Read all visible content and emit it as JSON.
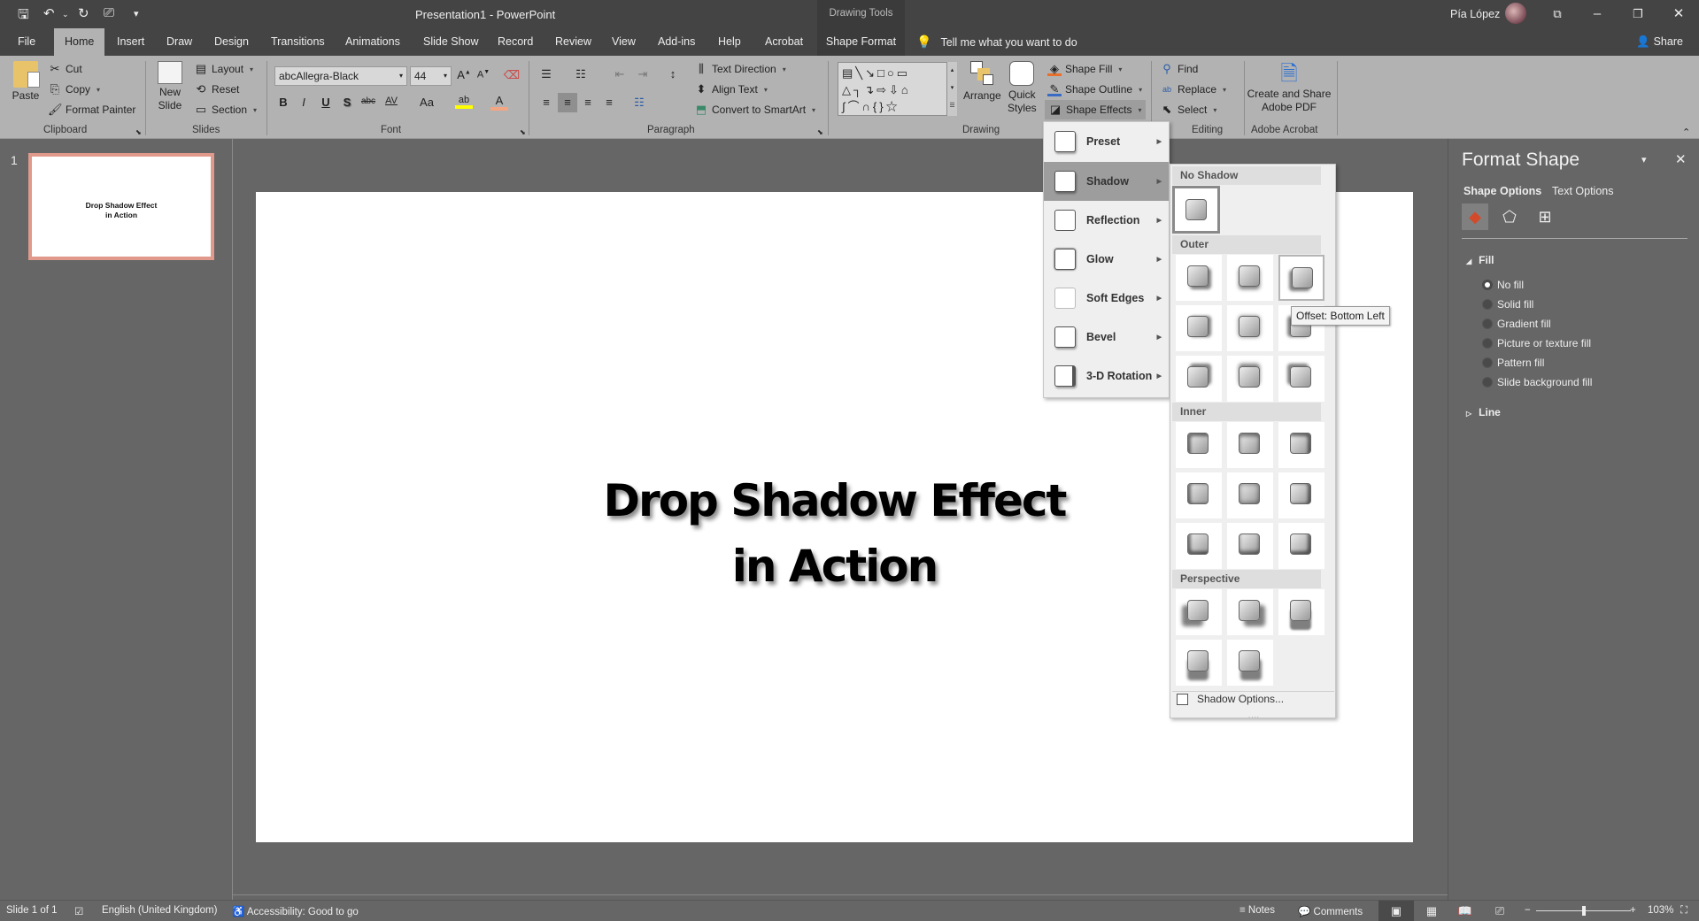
{
  "app": {
    "title": "Presentation1  -  PowerPoint",
    "contextual_group": "Drawing Tools",
    "user_name": "Pía López",
    "qat": {
      "save": "save-icon",
      "undo": "undo-icon",
      "redo": "redo-icon",
      "present": "present-from-start-icon",
      "customize": "customize-qat-icon"
    },
    "window_buttons": [
      "ribbon-display-options",
      "minimize",
      "restore",
      "close"
    ]
  },
  "tabs": [
    "File",
    "Home",
    "Insert",
    "Draw",
    "Design",
    "Transitions",
    "Animations",
    "Slide Show",
    "Record",
    "Review",
    "View",
    "Add-ins",
    "Help",
    "Acrobat",
    "Shape Format"
  ],
  "active_tab": "Home",
  "tell_me": "Tell me what you want to do",
  "share": "Share",
  "ribbon": {
    "clipboard": {
      "label": "Clipboard",
      "paste": "Paste",
      "cut": "Cut",
      "copy": "Copy",
      "format_painter": "Format Painter"
    },
    "slides": {
      "label": "Slides",
      "new_slide_1": "New",
      "new_slide_2": "Slide",
      "layout": "Layout",
      "reset": "Reset",
      "section": "Section"
    },
    "font": {
      "label": "Font",
      "font_name": "abcAllegra-Black",
      "font_size": "44",
      "bold": "B",
      "italic": "I",
      "underline": "U",
      "shadow": "S",
      "strike": "abc",
      "spacing": "AV",
      "case": "Aa",
      "grow": "A",
      "shrink": "A",
      "highlight_color": "#ffff00",
      "font_color": "#f4a582"
    },
    "paragraph": {
      "label": "Paragraph",
      "text_direction": "Text Direction",
      "align_text": "Align Text",
      "convert_smartart": "Convert to SmartArt"
    },
    "drawing": {
      "label": "Drawing",
      "arrange": "Arrange",
      "quick_styles_1": "Quick",
      "quick_styles_2": "Styles",
      "shape_fill": "Shape Fill",
      "shape_outline": "Shape Outline",
      "shape_effects": "Shape Effects"
    },
    "editing": {
      "label": "Editing",
      "find": "Find",
      "replace": "Replace",
      "select": "Select"
    },
    "acrobat": {
      "label": "Adobe Acrobat",
      "create_1": "Create and Share",
      "create_2": "Adobe PDF"
    }
  },
  "thumbnails": [
    {
      "number": "1",
      "line1": "Drop Shadow Effect",
      "line2": "in Action"
    }
  ],
  "slide": {
    "title_line1": "Drop Shadow Effect",
    "title_line2": "in Action"
  },
  "shape_effects_menu": {
    "items": [
      {
        "label": "Preset",
        "mnemonic": "P"
      },
      {
        "label": "Shadow",
        "mnemonic": "S",
        "active": true
      },
      {
        "label": "Reflection",
        "mnemonic": "R"
      },
      {
        "label": "Glow",
        "mnemonic": "G"
      },
      {
        "label": "Soft Edges",
        "mnemonic": "E"
      },
      {
        "label": "Bevel",
        "mnemonic": "B"
      },
      {
        "label": "3-D Rotation",
        "mnemonic": "D"
      }
    ]
  },
  "shadow_menu": {
    "no_shadow": "No Shadow",
    "outer": "Outer",
    "inner": "Inner",
    "perspective": "Perspective",
    "outer_count": 9,
    "inner_count": 9,
    "perspective_count": 5,
    "options": "Shadow Options...",
    "hovered": "Offset: Bottom Left"
  },
  "format_pane": {
    "title": "Format Shape",
    "tabs": [
      "Shape Options",
      "Text Options"
    ],
    "active_tab": "Shape Options",
    "icons": [
      "fill-line-icon",
      "effects-icon",
      "size-properties-icon"
    ],
    "fill_section": "Fill",
    "fill_options": [
      "No fill",
      "Solid fill",
      "Gradient fill",
      "Picture or texture fill",
      "Pattern fill",
      "Slide background fill"
    ],
    "selected_fill": "No fill",
    "line_section": "Line"
  },
  "status": {
    "slide_info": "Slide 1 of 1",
    "language": "English (United Kingdom)",
    "accessibility": "Accessibility: Good to go",
    "notes": "Notes",
    "comments": "Comments",
    "zoom": "103%",
    "zoom_level_percent": 103
  }
}
